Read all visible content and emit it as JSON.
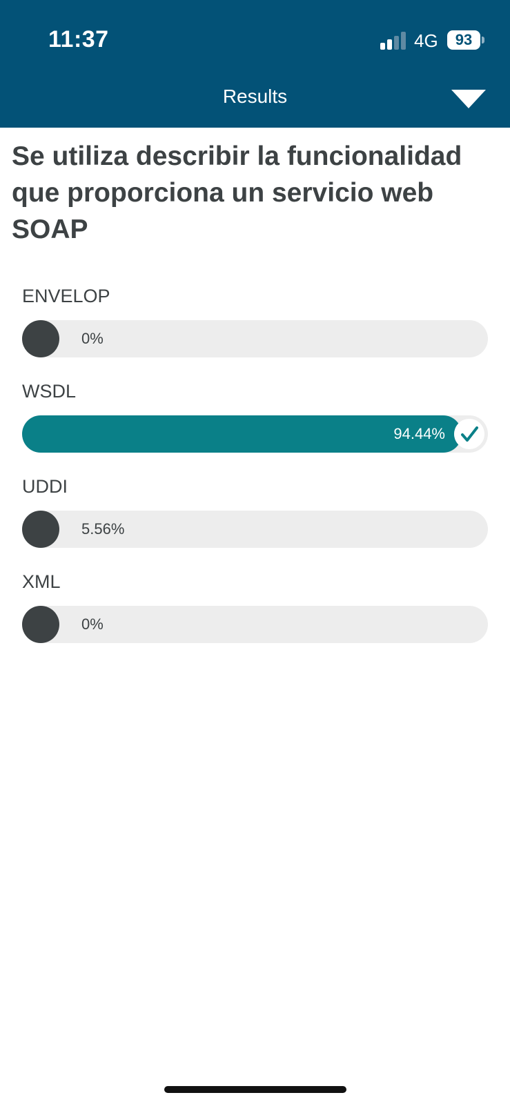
{
  "status_bar": {
    "time": "11:37",
    "network": "4G",
    "battery": "93"
  },
  "header": {
    "title": "Results",
    "toggle_icon": "triangle-down-icon",
    "background": "#035277"
  },
  "question": "Se utiliza describir la funcionalidad que proporciona un servicio web SOAP",
  "options": [
    {
      "label": "ENVELOP",
      "percent_text": "0%",
      "percent": 0,
      "correct": false
    },
    {
      "label": "WSDL",
      "percent_text": "94.44%",
      "percent": 94.44,
      "correct": true
    },
    {
      "label": "UDDI",
      "percent_text": "5.56%",
      "percent": 5.56,
      "correct": false
    },
    {
      "label": "XML",
      "percent_text": "0%",
      "percent": 0,
      "correct": false
    }
  ],
  "colors": {
    "correct_fill": "#0a8088",
    "fill": "#3d4244",
    "track": "#ededed"
  }
}
